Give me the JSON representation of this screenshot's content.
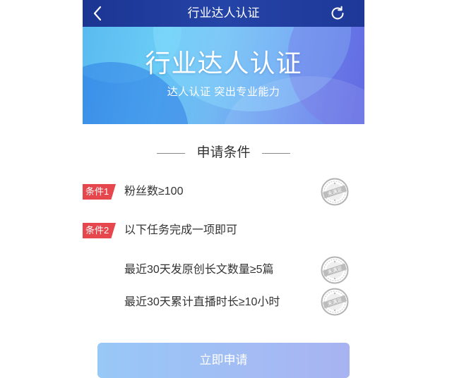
{
  "header": {
    "title": "行业达人认证",
    "back_icon": "chevron-left-icon",
    "refresh_icon": "refresh-icon"
  },
  "banner": {
    "title": "行业达人认证",
    "subtitle": "达人认证 突出专业能力"
  },
  "section": {
    "title": "申请条件"
  },
  "conditions": [
    {
      "tag": "条件1",
      "text": "粉丝数≥100",
      "status": "未满足",
      "status_icon": "stamp-icon"
    },
    {
      "tag": "条件2",
      "text": "以下任务完成一项即可",
      "subitems": [
        {
          "text": "最近30天发原创长文数量≥5篇",
          "status": "未满足",
          "status_icon": "stamp-icon"
        },
        {
          "text": "最近30天累计直播时长≥10小时",
          "status": "未满足",
          "status_icon": "stamp-icon"
        }
      ]
    }
  ],
  "apply_button": {
    "label": "立即申请"
  },
  "colors": {
    "header_bg": "#1f3c9d",
    "banner_start": "#4aa9ec",
    "banner_end": "#5c70e4",
    "tag_bg": "#e5474d",
    "stamp": "#b8b8b8",
    "button_start": "#97c8f6",
    "button_end": "#a8b3f2",
    "text": "#333333"
  }
}
